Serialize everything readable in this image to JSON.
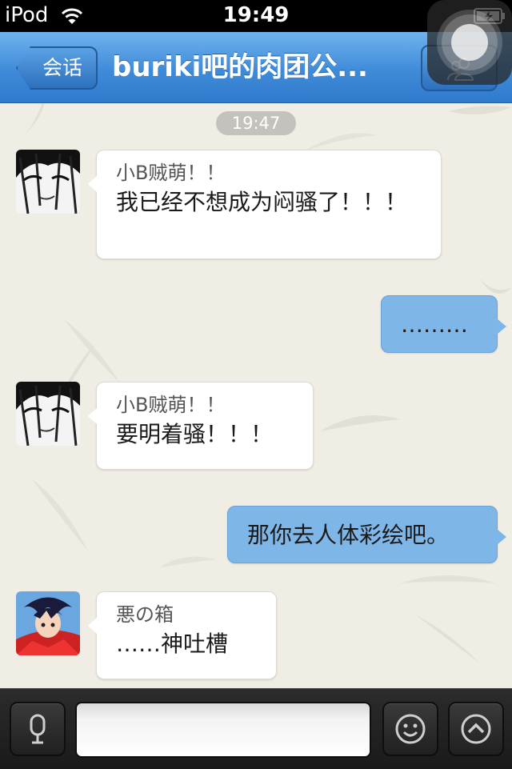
{
  "status_bar": {
    "carrier": "iPod",
    "time": "19:49"
  },
  "nav": {
    "back_label": "会话",
    "title": "buriki吧的肉团公..."
  },
  "chat": {
    "timestamp": "19:47",
    "messages": [
      {
        "direction": "in",
        "sender": "小B贼萌！！",
        "text": "我已经不想成为闷骚了！！！",
        "avatar": "manga-girl-avatar"
      },
      {
        "direction": "out",
        "text": "………"
      },
      {
        "direction": "in",
        "sender": "小B贼萌！！",
        "text": "要明着骚！！！",
        "avatar": "manga-girl-avatar"
      },
      {
        "direction": "out",
        "text": "那你去人体彩绘吧。"
      },
      {
        "direction": "in",
        "sender": "悪の箱",
        "text": "……神吐槽",
        "avatar": "anime-boy-avatar"
      }
    ]
  },
  "input": {
    "value": "",
    "placeholder": ""
  },
  "icons": {
    "voice": "microphone-icon",
    "emoji": "smiley-icon",
    "more": "chevron-up-icon"
  },
  "colors": {
    "nav_blue": "#3f8bd9",
    "outgoing_bubble": "#7fb6e8",
    "incoming_bubble": "#ffffff",
    "chat_background": "#efede4"
  }
}
